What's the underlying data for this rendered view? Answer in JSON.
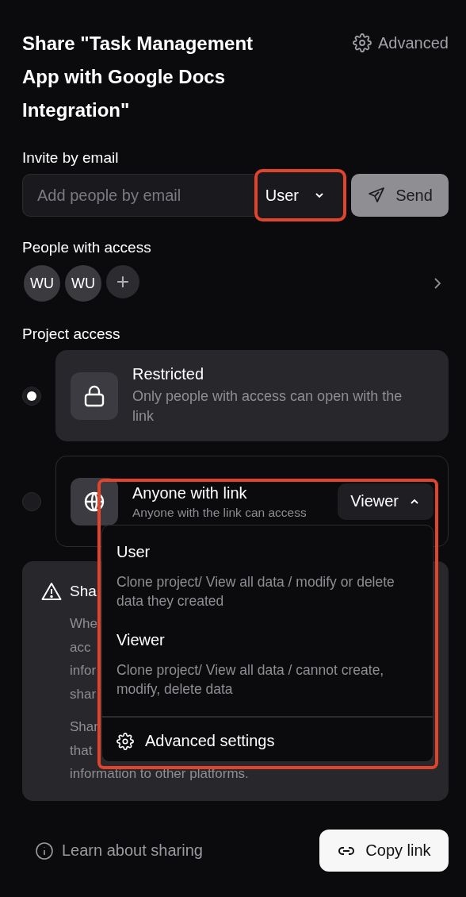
{
  "dialog": {
    "title": "Share \"Task Management App with Google Docs Integration\"",
    "advanced_button": "Advanced"
  },
  "invite": {
    "label": "Invite by email",
    "placeholder": "Add people by email",
    "role": "User",
    "role_highlighted": true,
    "send": "Send"
  },
  "people": {
    "label": "People with access",
    "avatars": [
      "WU",
      "WU"
    ],
    "add": "+"
  },
  "project_access": {
    "label": "Project access",
    "options": [
      {
        "kind": "restricted",
        "title": "Restricted",
        "description": "Only people with access can open with the link",
        "selected": true
      },
      {
        "kind": "link",
        "title": "Anyone with link",
        "description": "Anyone with the link can access",
        "selected": false,
        "role": "Viewer",
        "expanded": true
      }
    ]
  },
  "role_menu": {
    "highlighted": true,
    "items": [
      {
        "title": "User",
        "description": "Clone project/ View all data / modify or delete data they created"
      },
      {
        "title": "Viewer",
        "description": "Clone project/ View all data / cannot create, modify, delete data"
      }
    ],
    "footer": "Advanced settings"
  },
  "warning": {
    "title": "Sha",
    "paragraphs": [
      [
        "Whe",
        "acc",
        "infor",
        "shar"
      ],
      [
        "Shar",
        "that",
        "information to other platforms."
      ]
    ]
  },
  "footer": {
    "learn_link": "Learn about sharing",
    "copy_button": "Copy link"
  }
}
